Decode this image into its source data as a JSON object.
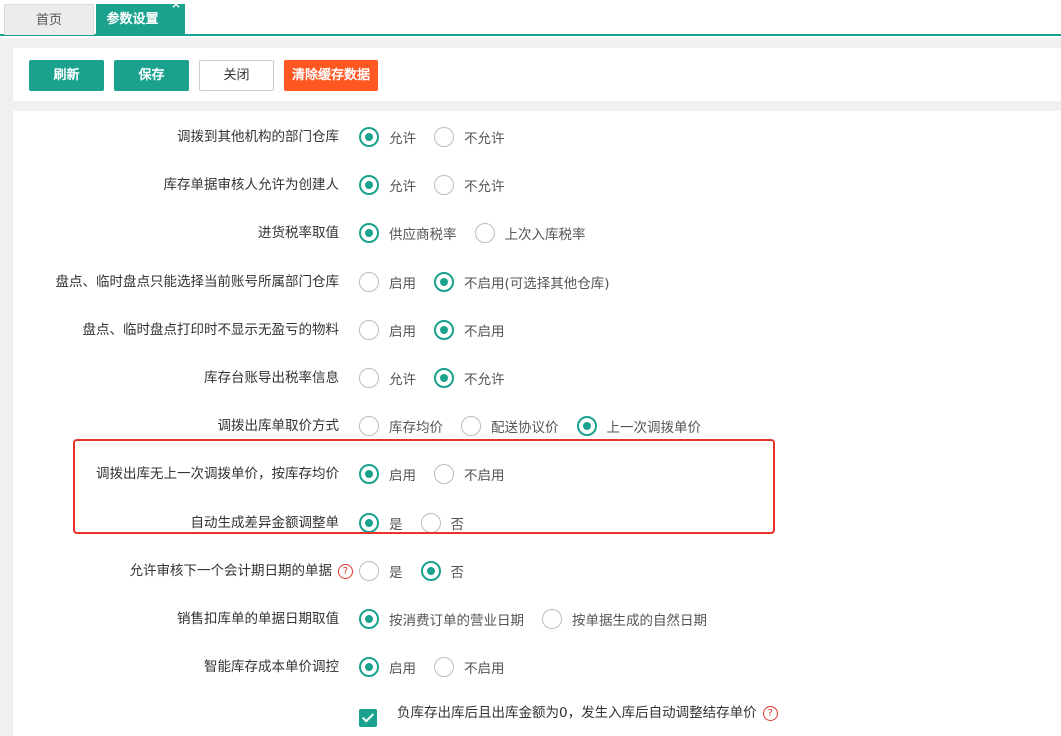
{
  "tabs": [
    {
      "label": "首页"
    },
    {
      "label": "参数设置",
      "close": "×"
    }
  ],
  "toolbar": {
    "refresh": "刷新",
    "save": "保存",
    "close": "关闭",
    "clear_cache": "清除缓存数据"
  },
  "settings": [
    {
      "label": "调拨到其他机构的部门仓库",
      "options": [
        "允许",
        "不允许"
      ],
      "selected": 0
    },
    {
      "label": "库存单据审核人允许为创建人",
      "options": [
        "允许",
        "不允许"
      ],
      "selected": 0
    },
    {
      "label": "进货税率取值",
      "options": [
        "供应商税率",
        "上次入库税率"
      ],
      "selected": 0
    },
    {
      "label": "盘点、临时盘点只能选择当前账号所属部门仓库",
      "options": [
        "启用",
        "不启用(可选择其他仓库)"
      ],
      "selected": 1
    },
    {
      "label": "盘点、临时盘点打印时不显示无盈亏的物料",
      "options": [
        "启用",
        "不启用"
      ],
      "selected": 1
    },
    {
      "label": "库存台账导出税率信息",
      "options": [
        "允许",
        "不允许"
      ],
      "selected": 1
    },
    {
      "label": "调拨出库单取价方式",
      "options": [
        "库存均价",
        "配送协议价",
        "上一次调拨单价"
      ],
      "selected": 2
    },
    {
      "label": "调拨出库无上一次调拨单价，按库存均价",
      "options": [
        "启用",
        "不启用"
      ],
      "selected": 0
    },
    {
      "label": "自动生成差异金额调整单",
      "options": [
        "是",
        "否"
      ],
      "selected": 0
    },
    {
      "label": "允许审核下一个会计期日期的单据",
      "help": "?",
      "options": [
        "是",
        "否"
      ],
      "selected": 1
    },
    {
      "label": "销售扣库单的单据日期取值",
      "options": [
        "按消费订单的营业日期",
        "按单据生成的自然日期"
      ],
      "selected": 0
    },
    {
      "label": "智能库存成本单价调控",
      "options": [
        "启用",
        "不启用"
      ],
      "selected": 0
    }
  ],
  "checkbox_setting": {
    "label": "负库存出库后且出库金额为0，发生入库后自动调整结存单价",
    "checked": true,
    "help": "?"
  },
  "colors": {
    "accent": "#1aa28e",
    "danger_button": "#ff5722",
    "highlight_border": "#e8332a"
  }
}
